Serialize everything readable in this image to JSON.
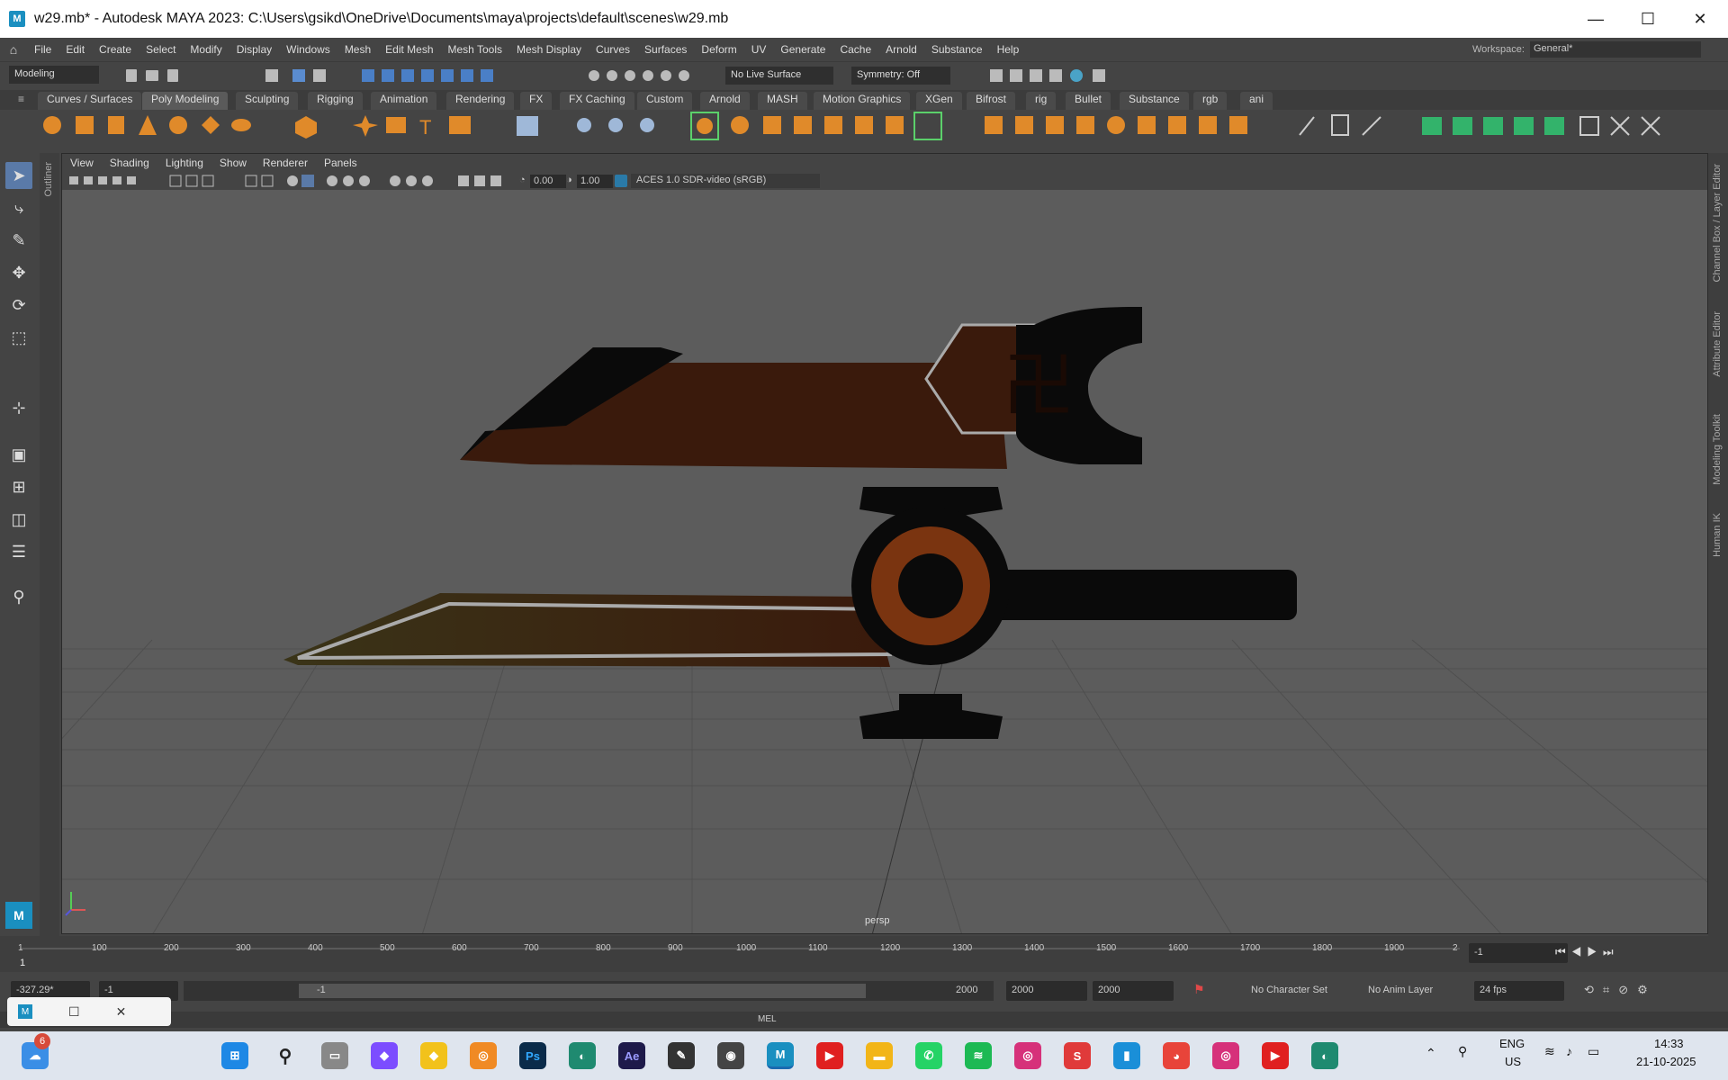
{
  "window": {
    "app_icon": "M",
    "title": "w29.mb* - Autodesk MAYA 2023: C:\\Users\\gsikd\\OneDrive\\Documents\\maya\\projects\\default\\scenes\\w29.mb",
    "minimize": "—",
    "maximize": "☐",
    "close": "✕"
  },
  "menu": {
    "items": [
      "File",
      "Edit",
      "Create",
      "Select",
      "Modify",
      "Display",
      "Windows",
      "Mesh",
      "Edit Mesh",
      "Mesh Tools",
      "Mesh Display",
      "Curves",
      "Surfaces",
      "Deform",
      "UV",
      "Generate",
      "Cache",
      "Arnold",
      "Substance",
      "Help"
    ],
    "workspace_label": "Workspace:",
    "workspace_value": "General*"
  },
  "statusline": {
    "mode": "Modeling",
    "live_surface": "No Live Surface",
    "symmetry": "Symmetry: Off"
  },
  "shelf_tabs": [
    "Curves / Surfaces",
    "Poly Modeling",
    "Sculpting",
    "Rigging",
    "Animation",
    "Rendering",
    "FX",
    "FX Caching",
    "Custom",
    "Arnold",
    "MASH",
    "Motion Graphics",
    "XGen",
    "Bifrost",
    "rig",
    "Bullet",
    "Substance",
    "rgb",
    "ani"
  ],
  "panel": {
    "menus": [
      "View",
      "Shading",
      "Lighting",
      "Show",
      "Renderer",
      "Panels"
    ],
    "exposure": "0.00",
    "gamma": "1.00",
    "colorspace": "ACES 1.0 SDR-video (sRGB)",
    "camera": "persp"
  },
  "side_labels": {
    "outliner": "Outliner",
    "channel_box": "Channel Box / Layer Editor",
    "attribute_editor": "Attribute Editor",
    "modeling_toolkit": "Modeling Toolkit",
    "human_ik": "Human IK"
  },
  "timeline": {
    "ticks": [
      "1",
      "100",
      "200",
      "300",
      "400",
      "500",
      "600",
      "700",
      "800",
      "900",
      "1000",
      "1100",
      "1200",
      "1300",
      "1400",
      "1500",
      "1600",
      "1700",
      "1800",
      "1900",
      "2"
    ],
    "start_marker": "1",
    "current_frame": "-1"
  },
  "range": {
    "left_value": "-327.29*",
    "start": "-1",
    "range_start": "-1",
    "range_end": "2000",
    "end1": "2000",
    "end2": "2000",
    "character_set": "No Character Set",
    "anim_layer": "No Anim Layer",
    "fps": "24 fps"
  },
  "mel": {
    "label": "MEL"
  },
  "taskbar": {
    "notification_count": "6",
    "lang": "ENG",
    "region": "US",
    "time": "14:33",
    "date": "21-10-2025"
  },
  "colors": {
    "viewport_bg": "#5c5c5c",
    "ui_bg": "#444444",
    "blade_brown": "#3a1a0c",
    "guard_orange": "#7a3410"
  }
}
